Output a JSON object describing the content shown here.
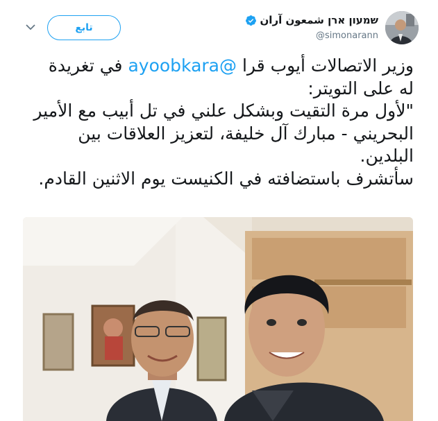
{
  "header": {
    "follow_label": "تابع",
    "display_name": "שמעון ארן شمعون آران",
    "handle": "@simonarann"
  },
  "tweet": {
    "line_1_pre": "وزير الاتصالات أيوب قرا",
    "mention": "@ayoobkara",
    "line_1_post": "في تغريدة",
    "body_rest": "له على التويتر:\n\"لأول مرة التقيت وبشكل علني في تل أبيب مع الأمير البحريني - مبارك آل خليفة، لتعزيز العلاقات بين البلدين.\nسأتشرف باستضافته في الكنيست يوم الاثنين القادم."
  },
  "colors": {
    "brand_blue": "#1da1f2",
    "text": "#14171a",
    "muted": "#657786"
  },
  "icons": {
    "menu": "chevron-down-icon",
    "verified": "verified-badge-icon"
  }
}
